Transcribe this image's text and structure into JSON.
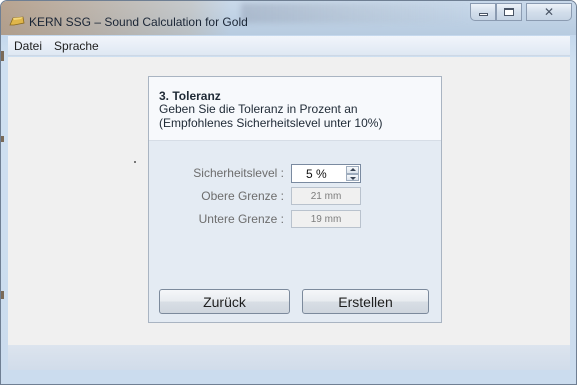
{
  "window": {
    "title": "KERN SSG – Sound Calculation for Gold"
  },
  "menu": {
    "items": [
      "Datei",
      "Sprache"
    ]
  },
  "step": {
    "title": "3. Toleranz",
    "description_line1": "Geben Sie die Toleranz in Prozent an",
    "description_line2": "(Empfohlenes Sicherheitslevel unter 10%)"
  },
  "fields": {
    "security_level": {
      "label": "Sicherheitslevel :",
      "value": "5 %"
    },
    "upper_limit": {
      "label": "Obere Grenze :",
      "value": "21 mm"
    },
    "lower_limit": {
      "label": "Untere Grenze :",
      "value": "19 mm"
    }
  },
  "buttons": {
    "back": "Zurück",
    "create": "Erstellen"
  },
  "icons": {
    "app": "gold-bar-icon",
    "minimize": "minimize-icon",
    "maximize": "maximize-icon",
    "close": "close-icon",
    "spin_up": "chevron-up-icon",
    "spin_down": "chevron-down-icon"
  },
  "colors": {
    "window_frame": "#c3d7ec",
    "client_background": "#f0f0f0",
    "panel_background": "#e4ebf3",
    "panel_header": "#f7f9fc"
  }
}
